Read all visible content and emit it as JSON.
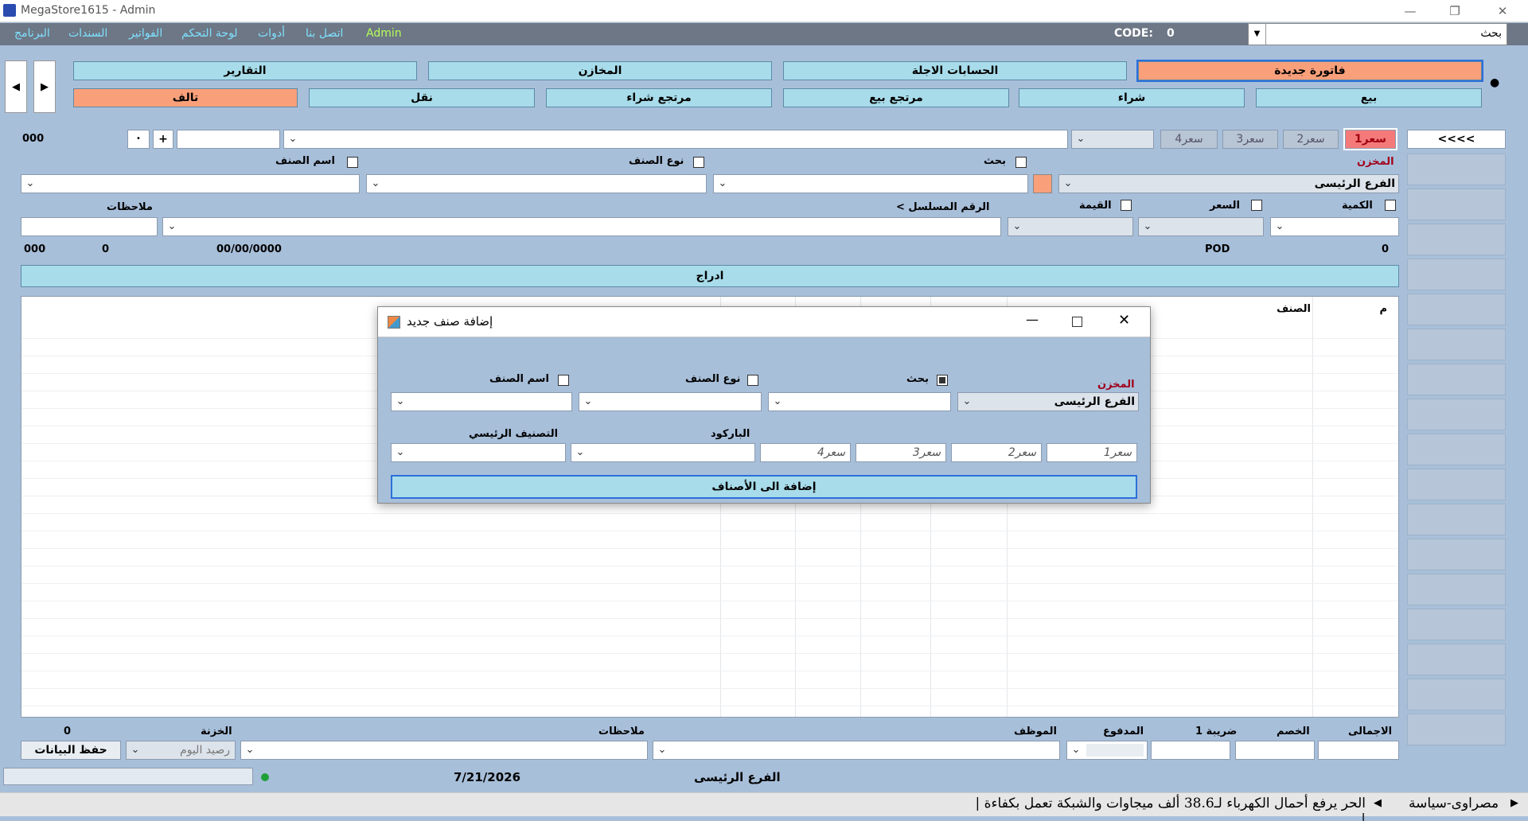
{
  "window": {
    "title": "MegaStore1615 - Admin"
  },
  "menu": {
    "items": [
      "البرنامج",
      "السندات",
      "الفواتير",
      "لوحة التحكم",
      "أدوات",
      "اتصل بنا"
    ],
    "admin": "Admin",
    "code_label": "CODE:",
    "code_value": "0",
    "search_value": "بحث"
  },
  "toolbar": {
    "row1": [
      "فاتورة جديدة",
      "الحسابات الاجلة",
      "المخازن",
      "التقارير"
    ],
    "row2": [
      "بيع",
      "شراء",
      "مرتجع بيع",
      "مرتجع شراء",
      "نقل",
      "تالف"
    ]
  },
  "prices": {
    "tabs": [
      "سعر1",
      "سعر2",
      "سعر3",
      "سعر4"
    ],
    "more": "<<<<"
  },
  "item_row": {
    "count": "000",
    "plus": "+",
    "dot": "•"
  },
  "filters": {
    "store_label": "المخزن",
    "store_value": "الفرع الرئيسى",
    "search_label": "بحث",
    "type_label": "نوع الصنف",
    "name_label": "اسم الصنف"
  },
  "options": {
    "qty_label": "الكمية",
    "price_label": "السعر",
    "value_label": "القيمة",
    "serial_label": "< الرقم المسلسل",
    "notes_label": "ملاحظات"
  },
  "status_row": {
    "right_zero": "0",
    "pod": "POD",
    "date": "00/00/0000",
    "zero": "0",
    "left": "000"
  },
  "insert_label": "ادراج",
  "grid": {
    "col_m": "م",
    "col_item": "الصنف"
  },
  "dialog": {
    "title": "إضافة صنف جديد",
    "store_label": "المخزن",
    "store_value": "الفرع الرئيسى",
    "search_label": "بحث",
    "type_label": "نوع الصنف",
    "name_label": "اسم الصنف",
    "barcode_label": "الباركود",
    "main_cat_label": "التصنيف الرئيسي",
    "price_placeholders": [
      "سعر1",
      "سعر2",
      "سعر3",
      "سعر4"
    ],
    "add_button": "إضافة الى الأصناف"
  },
  "footer": {
    "total_label": "الاجمالى",
    "discount_label": "الخصم",
    "tax_label": "ضريبة 1",
    "paid_label": "المدفوع",
    "employee_label": "الموظف",
    "notes_label": "ملاحظات",
    "cash_label": "الخزنة",
    "cash_value": "رصيد اليوم",
    "zero": "0",
    "save_button": "حفظ البيانات",
    "branch": "الفرع الرئيسى",
    "date": "7/21/2026"
  },
  "ticker": {
    "source": "مصراوى-سياسة",
    "headline": "الحر يرفع أحمال الكهرباء لـ38.6 ألف ميجاوات والشبكة تعمل بكفاءة | |"
  }
}
